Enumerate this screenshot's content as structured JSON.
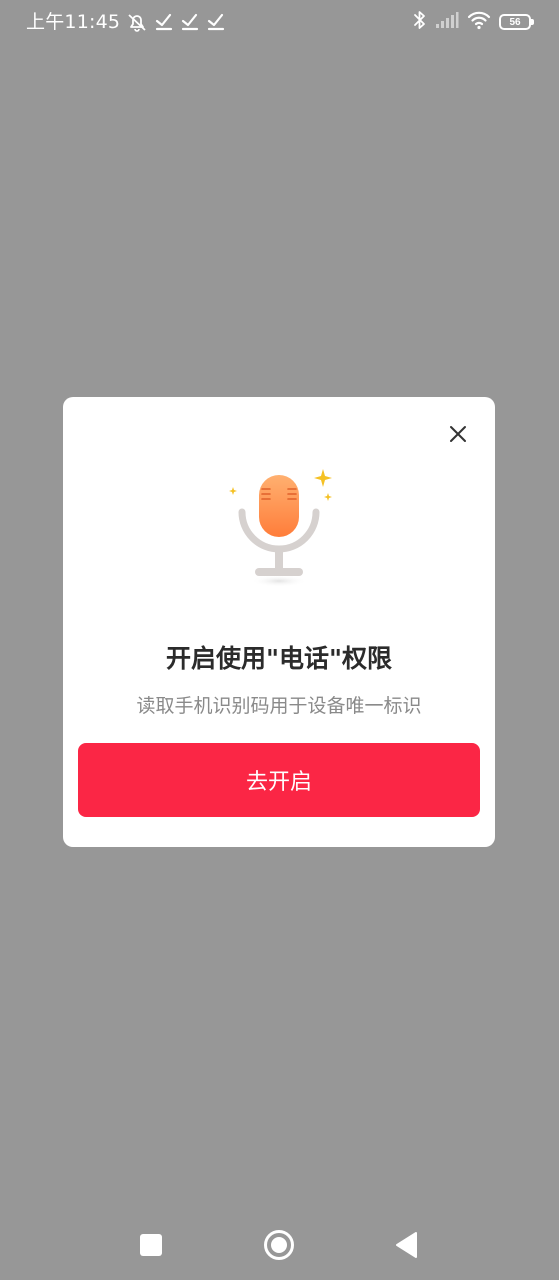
{
  "status_bar": {
    "time": "上午11:45",
    "battery": "56",
    "icons": [
      "alarm-off-icon",
      "check-icon",
      "check-icon",
      "check-icon",
      "bluetooth-icon",
      "signal-icon",
      "wifi-icon",
      "battery-icon"
    ]
  },
  "dialog": {
    "icon": "microphone-icon",
    "title": "开启使用\"电话\"权限",
    "subtitle": "读取手机识别码用于设备唯一标识",
    "button_label": "去开启",
    "close_icon": "close-icon"
  },
  "nav_bar": {
    "icons": [
      "recents-square-icon",
      "home-circle-icon",
      "back-triangle-icon"
    ]
  },
  "colors": {
    "overlay": "#979797",
    "dialog_bg": "#ffffff",
    "primary": "#fb2645",
    "title": "#2b2b2b",
    "subtitle": "#8a8a8a",
    "mic_orange": "#ff8f4a",
    "mic_stand": "#d3cfcd",
    "sparkle": "#f5c124"
  }
}
